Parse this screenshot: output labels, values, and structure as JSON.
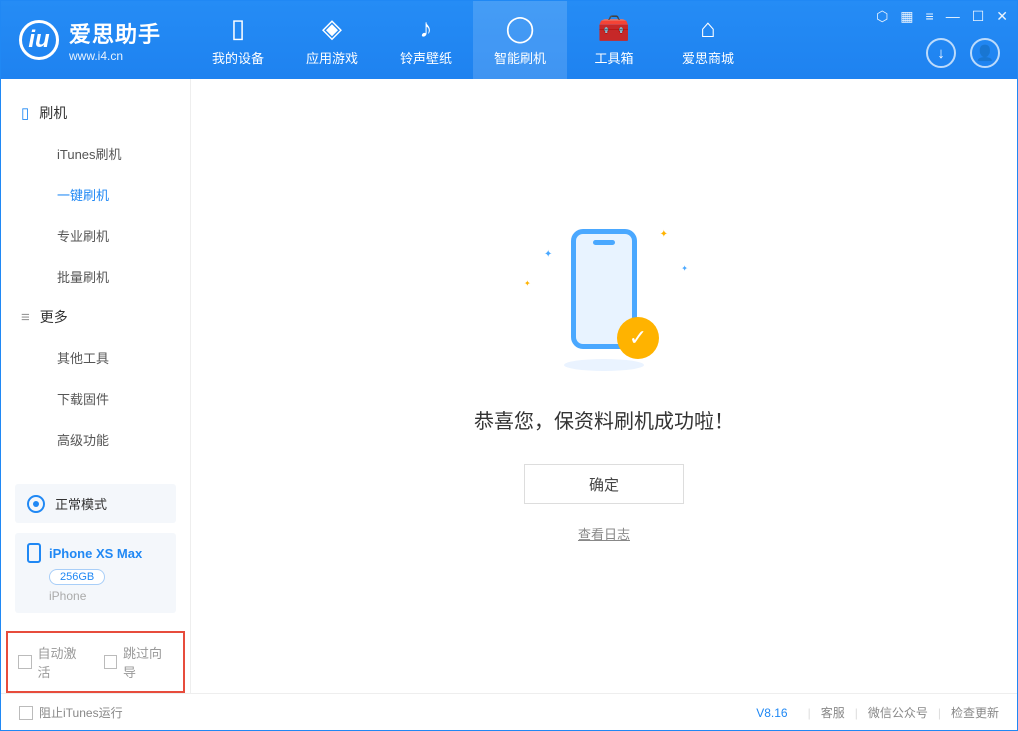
{
  "app": {
    "title": "爱思助手",
    "subtitle": "www.i4.cn"
  },
  "nav": {
    "tabs": [
      {
        "label": "我的设备"
      },
      {
        "label": "应用游戏"
      },
      {
        "label": "铃声壁纸"
      },
      {
        "label": "智能刷机"
      },
      {
        "label": "工具箱"
      },
      {
        "label": "爱思商城"
      }
    ]
  },
  "sidebar": {
    "group1": {
      "title": "刷机",
      "items": [
        "iTunes刷机",
        "一键刷机",
        "专业刷机",
        "批量刷机"
      ]
    },
    "group2": {
      "title": "更多",
      "items": [
        "其他工具",
        "下载固件",
        "高级功能"
      ]
    }
  },
  "mode": {
    "label": "正常模式"
  },
  "device": {
    "name": "iPhone XS Max",
    "storage": "256GB",
    "type": "iPhone"
  },
  "options": {
    "auto_activate": "自动激活",
    "skip_guide": "跳过向导"
  },
  "main": {
    "success_text": "恭喜您，保资料刷机成功啦！",
    "ok_button": "确定",
    "view_log": "查看日志"
  },
  "footer": {
    "block_itunes": "阻止iTunes运行",
    "version": "V8.16",
    "support": "客服",
    "wechat": "微信公众号",
    "check_update": "检查更新"
  }
}
